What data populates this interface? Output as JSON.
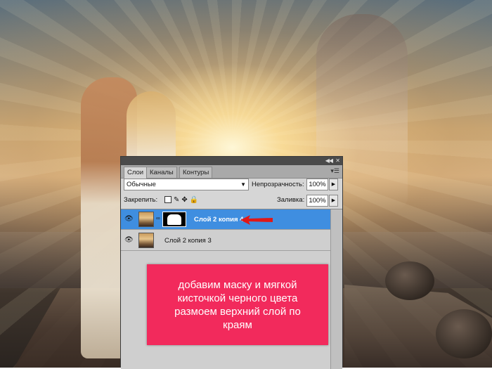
{
  "panel": {
    "tabs": [
      {
        "label": "Слои",
        "active": true
      },
      {
        "label": "Каналы",
        "active": false
      },
      {
        "label": "Контуры",
        "active": false
      }
    ],
    "blend_mode": "Обычные",
    "opacity_label": "Непрозрачность:",
    "opacity_value": "100%",
    "lock_label": "Закрепить:",
    "fill_label": "Заливка:",
    "fill_value": "100%",
    "layers": [
      {
        "name": "Слой 2 копия 4",
        "selected": true,
        "has_mask": true,
        "visible": true
      },
      {
        "name": "Слой 2 копия 3",
        "selected": false,
        "has_mask": false,
        "visible": true
      }
    ],
    "icons": {
      "collapse": "double-chevron-icon",
      "close": "close-icon",
      "menu": "panel-menu-icon",
      "visibility": "eye-icon",
      "link": "chain-icon",
      "arrow_pointer": "red-arrow-icon"
    }
  },
  "annotation": {
    "text": "добавим маску  и мягкой кисточкой черного цвета размоем верхний слой по краям",
    "background": "#f22a5c"
  },
  "colors": {
    "selected_layer": "#3f8ee0",
    "arrow": "#e01818"
  }
}
